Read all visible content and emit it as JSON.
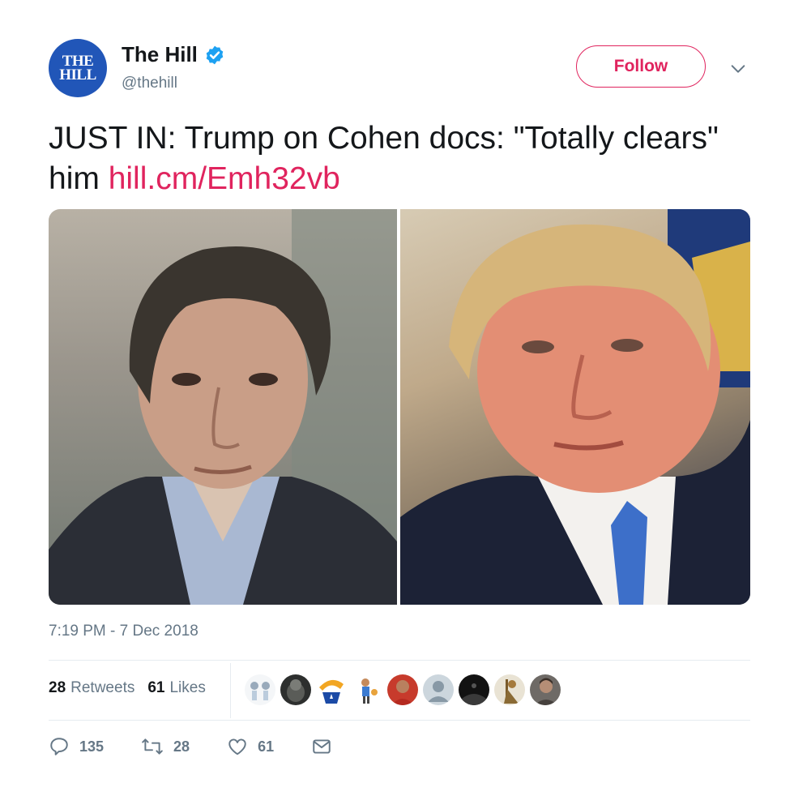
{
  "author": {
    "display_name": "The Hill",
    "handle": "@thehill",
    "avatar_line1": "THE",
    "avatar_line2": "HILL",
    "verified": true
  },
  "follow_label": "Follow",
  "tweet": {
    "text": "JUST IN: Trump on Cohen docs: \"Totally clears\" him ",
    "link": "hill.cm/Emh32vb"
  },
  "timestamp": "7:19 PM - 7 Dec 2018",
  "stats": {
    "retweets_count": "28",
    "retweets_label": "Retweets",
    "likes_count": "61",
    "likes_label": "Likes"
  },
  "actions": {
    "reply_count": "135",
    "retweet_count": "28",
    "like_count": "61"
  },
  "colors": {
    "accent": "#e0245e",
    "verified": "#1da1f2",
    "muted": "#657786",
    "avatar": "#2156b8"
  },
  "icons": [
    "verified-icon",
    "chevron-down-icon",
    "reply-icon",
    "retweet-icon",
    "heart-icon",
    "message-icon"
  ]
}
